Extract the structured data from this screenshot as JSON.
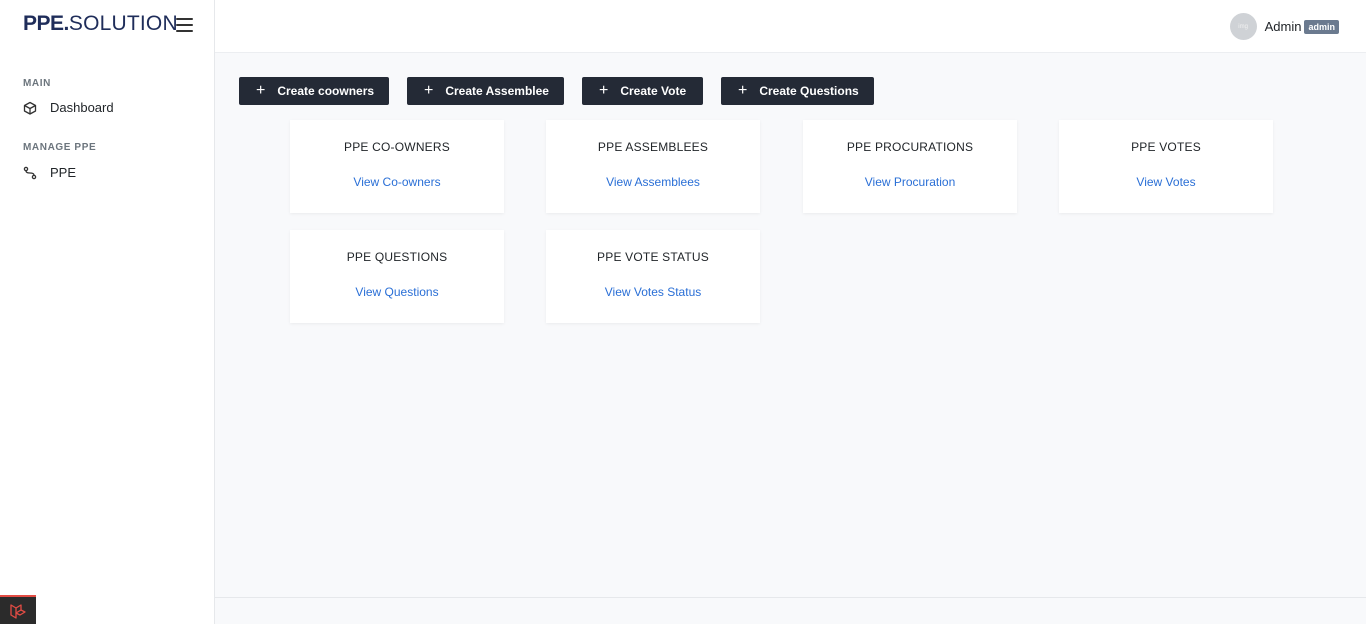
{
  "brand": {
    "strong": "PPE.",
    "light": "SOLUTION"
  },
  "sidebar": {
    "sections": [
      {
        "heading": "MAIN",
        "items": [
          {
            "label": "Dashboard",
            "icon": "cube-icon"
          }
        ]
      },
      {
        "heading": "MANAGE PPE",
        "items": [
          {
            "label": "PPE",
            "icon": "route-icon"
          }
        ]
      }
    ]
  },
  "topbar": {
    "user_name": "Admin",
    "user_role": "admin",
    "avatar_text": "img"
  },
  "actions": [
    {
      "label": "Create coowners"
    },
    {
      "label": "Create Assemblee"
    },
    {
      "label": "Create Vote"
    },
    {
      "label": "Create Questions"
    }
  ],
  "cards": [
    {
      "title": "PPE CO-OWNERS",
      "link": "View Co-owners"
    },
    {
      "title": "PPE ASSEMBLEES",
      "link": "View Assemblees"
    },
    {
      "title": "PPE PROCURATIONS",
      "link": "View Procuration"
    },
    {
      "title": "PPE VOTES",
      "link": "View Votes"
    },
    {
      "title": "PPE QUESTIONS",
      "link": "View Questions"
    },
    {
      "title": "PPE VOTE STATUS",
      "link": "View Votes Status"
    }
  ],
  "colors": {
    "brand": "#1f2d5a",
    "button_bg": "#242a36",
    "link": "#2a6fd6",
    "badge": "#6b7a8f"
  }
}
